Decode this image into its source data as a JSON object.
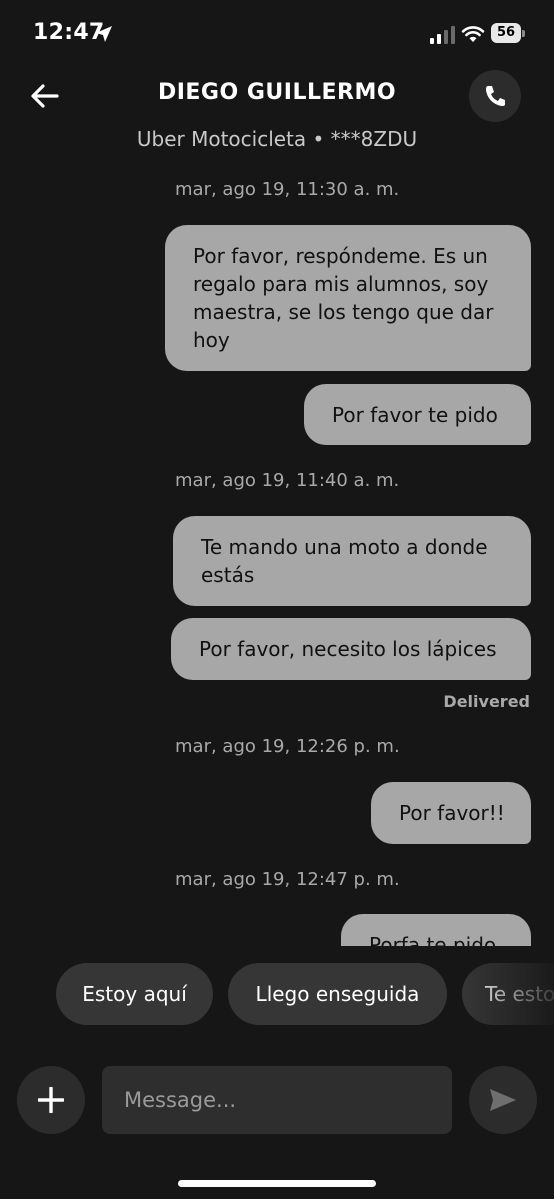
{
  "status_bar": {
    "time": "12:47",
    "battery": "56",
    "icons": [
      "location-arrow-icon",
      "cellular-signal-icon",
      "wifi-icon",
      "battery-icon"
    ]
  },
  "header": {
    "back_icon": "arrow-left-icon",
    "title": "DIEGO GUILLERMO",
    "subtitle": "Uber Motocicleta • ***8ZDU",
    "call_icon": "phone-icon"
  },
  "messages": {
    "ts_0": "mar, ago 19, 11:30 a. m.",
    "msg_1": "Por favor, respóndeme. Es un regalo para mis alumnos, soy maestra, se los tengo que dar hoy",
    "msg_2": "Por favor te pido",
    "ts_1": "mar, ago 19, 11:40 a. m.",
    "msg_3": "Te mando una moto a donde estás",
    "msg_4": "Por favor, necesito los lápices",
    "delivered": "Delivered",
    "ts_2": "mar, ago 19, 12:26 p. m.",
    "msg_5": "Por favor!!",
    "ts_3": "mar, ago 19, 12:47 p. m.",
    "msg_6": "Porfa te pido"
  },
  "quick_replies": [
    "Estoy aquí",
    "Llego enseguida",
    "Te estoy"
  ],
  "composer": {
    "placeholder": "Message...",
    "add_icon": "plus-icon",
    "send_icon": "send-icon"
  },
  "colors": {
    "background": "#161616",
    "bubble": "#a7a7a7",
    "chip": "#363636",
    "timestamp": "#a9a9a9"
  }
}
